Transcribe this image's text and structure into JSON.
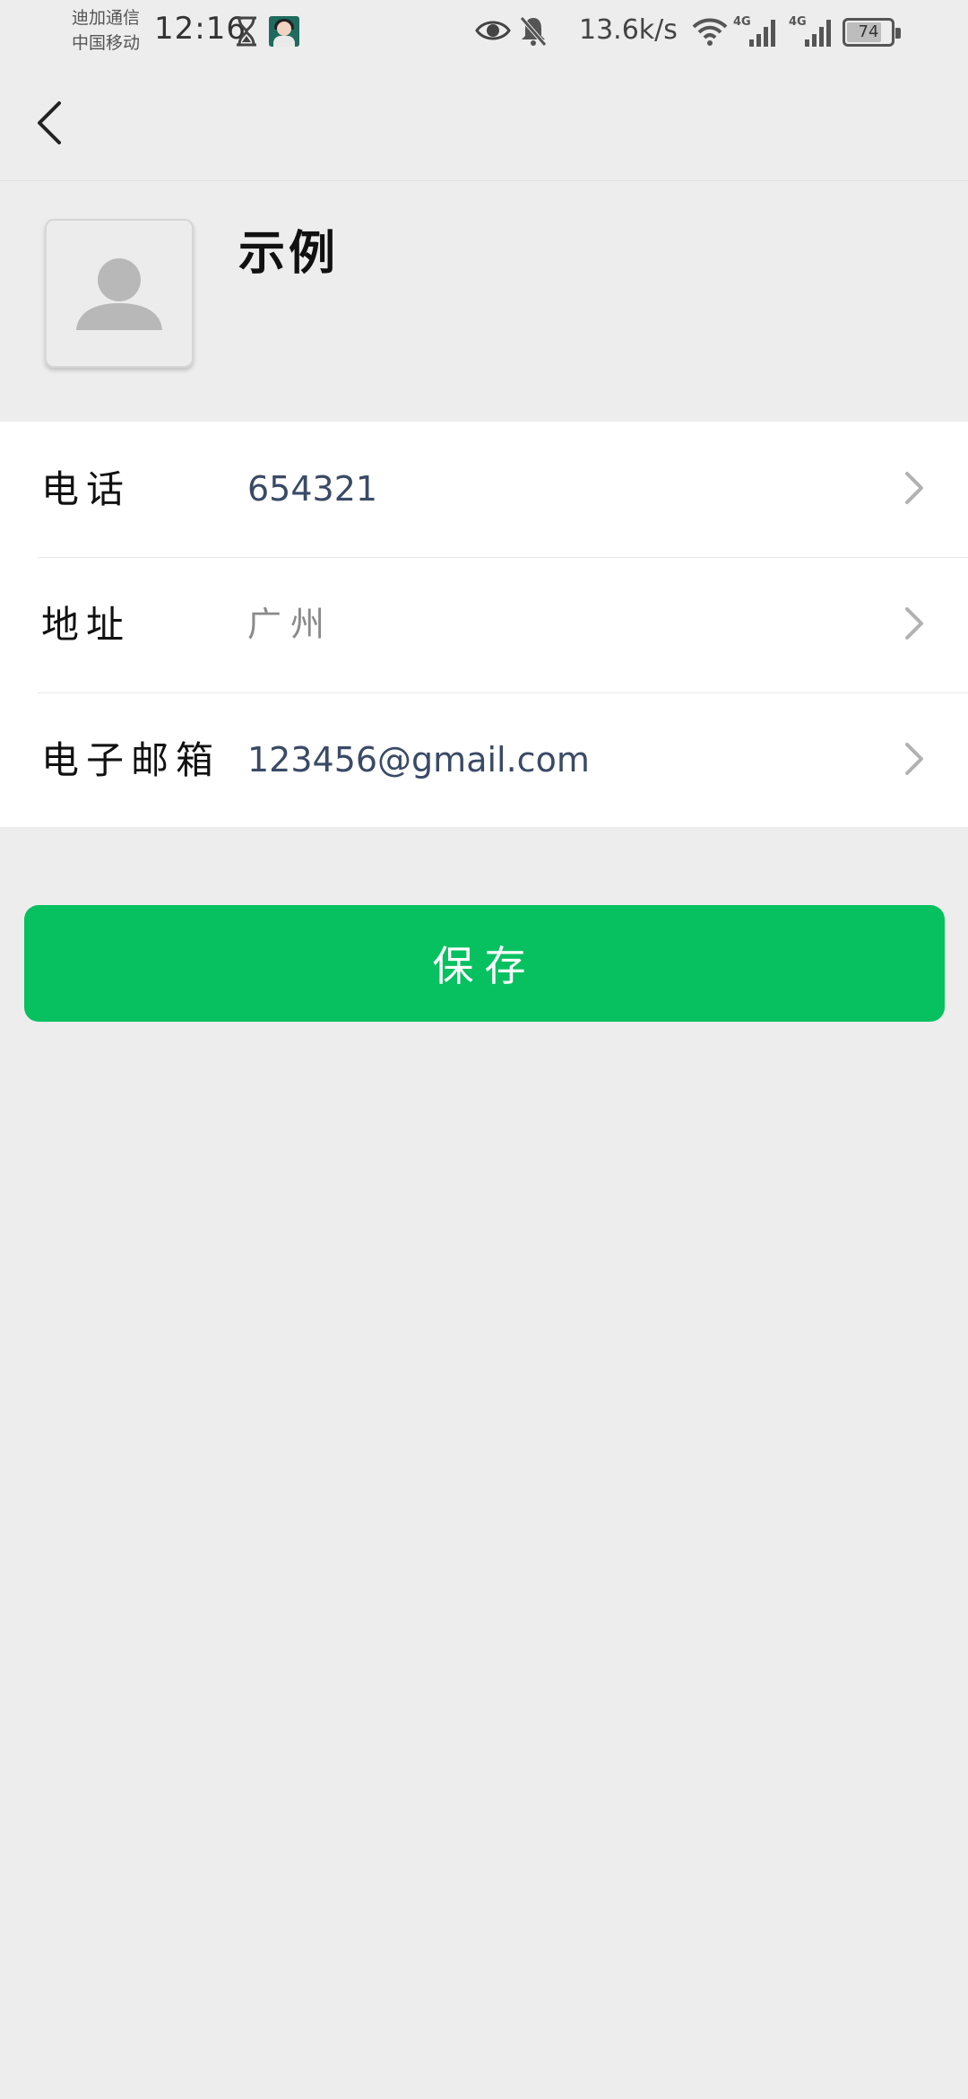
{
  "status_bar": {
    "carrier_line1": "迪加通信",
    "carrier_line2": "中国移动",
    "time": "12:16",
    "net_speed": "13.6k/s",
    "network_type_1": "4G",
    "network_type_2": "4G",
    "battery_level": "74",
    "icons": [
      "hourglass-icon",
      "app-notification-icon",
      "eye-icon",
      "bell-muted-icon",
      "wifi-icon",
      "signal-icon",
      "signal-icon",
      "battery-icon"
    ]
  },
  "nav": {
    "back_icon": "chevron-left-icon"
  },
  "profile": {
    "avatar_icon": "default-avatar-icon",
    "name": "示例"
  },
  "fields": [
    {
      "label": "电话",
      "value": "654321"
    },
    {
      "label": "地址",
      "value": "广州"
    },
    {
      "label": "电子邮箱",
      "value": "123456@gmail.com"
    }
  ],
  "actions": {
    "save_label": "保存"
  },
  "colors": {
    "background": "#ededed",
    "card": "#ffffff",
    "primary_button": "#07c160",
    "value_text": "#3a4a66"
  }
}
